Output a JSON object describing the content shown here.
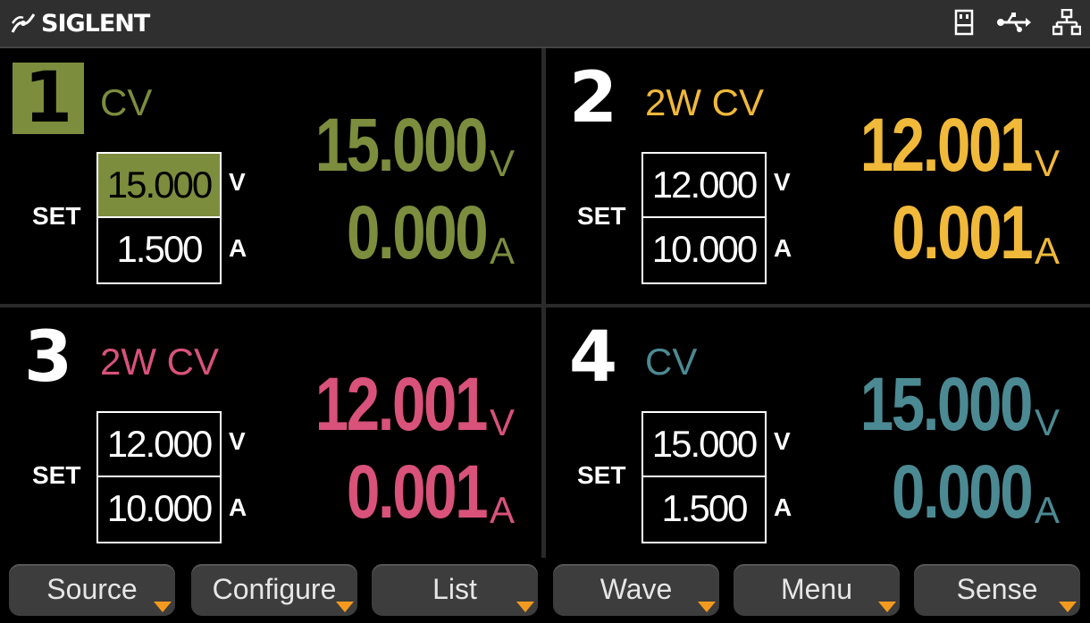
{
  "brand": {
    "name": "SIGLENT"
  },
  "status_icons": [
    "usb-storage-icon",
    "usb-icon",
    "network-icon"
  ],
  "colors": {
    "ch1": "#7c8d3e",
    "ch2": "#f0b93a",
    "ch3": "#d8527a",
    "ch4": "#4c8a93",
    "selected_bg": "#7c8d3e",
    "softkey_arrow": "#f39a1e"
  },
  "channels": [
    {
      "number": "1",
      "mode": "CV",
      "voltage": "15.000",
      "voltage_unit": "V",
      "current": "0.000",
      "current_unit": "A",
      "set_label": "SET",
      "set_voltage": "15.000",
      "set_voltage_unit": "V",
      "set_current": "1.500",
      "set_current_unit": "A"
    },
    {
      "number": "2",
      "mode": "2W CV",
      "voltage": "12.001",
      "voltage_unit": "V",
      "current": "0.001",
      "current_unit": "A",
      "set_label": "SET",
      "set_voltage": "12.000",
      "set_voltage_unit": "V",
      "set_current": "10.000",
      "set_current_unit": "A"
    },
    {
      "number": "3",
      "mode": "2W CV",
      "voltage": "12.001",
      "voltage_unit": "V",
      "current": "0.001",
      "current_unit": "A",
      "set_label": "SET",
      "set_voltage": "12.000",
      "set_voltage_unit": "V",
      "set_current": "10.000",
      "set_current_unit": "A"
    },
    {
      "number": "4",
      "mode": "CV",
      "voltage": "15.000",
      "voltage_unit": "V",
      "current": "0.000",
      "current_unit": "A",
      "set_label": "SET",
      "set_voltage": "15.000",
      "set_voltage_unit": "V",
      "set_current": "1.500",
      "set_current_unit": "A"
    }
  ],
  "softkeys": [
    "Source",
    "Configure",
    "List",
    "Wave",
    "Menu",
    "Sense"
  ]
}
